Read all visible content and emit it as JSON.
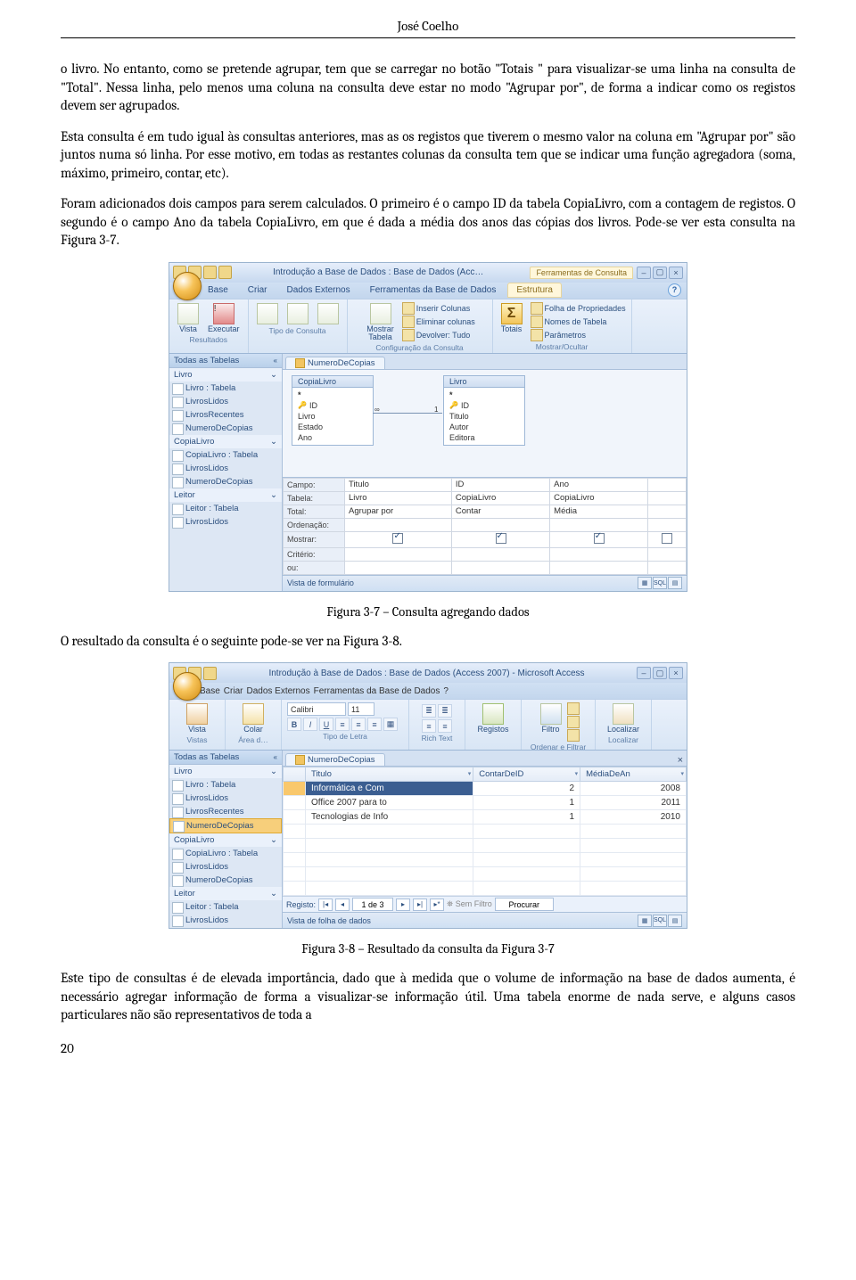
{
  "header": {
    "author": "José Coelho"
  },
  "paras": {
    "p1": "o livro. No entanto, como se pretende agrupar, tem que se carregar no botão \"Totais \" para visualizar-se uma linha na consulta de \"Total\". Nessa linha, pelo menos uma coluna na consulta deve estar no modo \"Agrupar por\", de forma a indicar como os registos devem ser agrupados.",
    "p2": "Esta consulta é em tudo igual às consultas anteriores, mas as os registos que tiverem o mesmo valor na coluna em \"Agrupar por\" são juntos numa só linha. Por esse motivo, em todas as restantes colunas da consulta tem que se indicar uma função agregadora (soma, máximo, primeiro, contar, etc).",
    "p3": "Foram adicionados dois campos para serem calculados. O primeiro é o campo ID da tabela CopiaLivro, com a contagem de registos. O segundo é o campo Ano da tabela CopiaLivro, em que é dada a média dos anos das cópias dos livros. Pode-se ver esta consulta na Figura 3-7.",
    "cap1": "Figura 3-7 – Consulta agregando dados",
    "p4": "O resultado da consulta é o seguinte pode-se ver na Figura 3-8.",
    "cap2": "Figura 3-8 – Resultado da consulta da Figura 3-7",
    "p5": "Este tipo de consultas é de elevada importância, dado que à medida que o volume de informação na base de dados aumenta, é necessário agregar informação de forma a visualizar-se informação útil. Uma tabela enorme de nada serve, e alguns casos particulares não são representativos de toda a",
    "pagenum": "20"
  },
  "shot1": {
    "title": "Introdução a Base de Dados : Base de Dados (Acc…",
    "ctxTitle": "Ferramentas de Consulta",
    "tabs": {
      "base": "Base",
      "criar": "Criar",
      "dados": "Dados Externos",
      "ferr": "Ferramentas da Base de Dados",
      "estrutura": "Estrutura"
    },
    "ribbon": {
      "vista": "Vista",
      "executar": "Executar",
      "resultados": "Resultados",
      "tipo": "Tipo de Consulta",
      "mostrarTabela": "Mostrar\nTabela",
      "inserir": "Inserir Colunas",
      "eliminar": "Eliminar colunas",
      "devolver": "Devolver: Tudo",
      "config": "Configuração da Consulta",
      "totais": "Totais",
      "folha": "Folha de Propriedades",
      "nomes": "Nomes de Tabela",
      "param": "Parâmetros",
      "mostocul": "Mostrar/Ocultar"
    },
    "nav": {
      "header": "Todas as Tabelas",
      "g1": "Livro",
      "g1items": [
        "Livro : Tabela",
        "LivrosLidos",
        "LivrosRecentes",
        "NumeroDeCopias"
      ],
      "g2": "CopiaLivro",
      "g2items": [
        "CopiaLivro : Tabela",
        "LivrosLidos",
        "NumeroDeCopias"
      ],
      "g3": "Leitor",
      "g3items": [
        "Leitor : Tabela",
        "LivrosLidos"
      ]
    },
    "designTab": "NumeroDeCopias",
    "box1": {
      "title": "CopiaLivro",
      "fields": [
        "*",
        "ID",
        "Livro",
        "Estado",
        "Ano"
      ]
    },
    "box2": {
      "title": "Livro",
      "fields": [
        "*",
        "ID",
        "Titulo",
        "Autor",
        "Editora"
      ]
    },
    "grid": {
      "rows": [
        "Campo:",
        "Tabela:",
        "Total:",
        "Ordenação:",
        "Mostrar:",
        "Critério:",
        "ou:"
      ],
      "cols": [
        {
          "campo": "Titulo",
          "tabela": "Livro",
          "total": "Agrupar por",
          "mostrar": true
        },
        {
          "campo": "ID",
          "tabela": "CopiaLivro",
          "total": "Contar",
          "mostrar": true
        },
        {
          "campo": "Ano",
          "tabela": "CopiaLivro",
          "total": "Média",
          "mostrar": true
        }
      ]
    },
    "status": "Vista de formulário"
  },
  "shot2": {
    "title": "Introdução à Base de Dados : Base de Dados (Access 2007) - Microsoft Access",
    "tabs": {
      "base": "Base",
      "criar": "Criar",
      "dados": "Dados Externos",
      "ferr": "Ferramentas da Base de Dados"
    },
    "ribbon": {
      "vista": "Vista",
      "colar": "Colar",
      "vistas": "Vistas",
      "areatransf": "Área d…",
      "font": "Calibri",
      "size": "11",
      "tipoLetra": "Tipo de Letra",
      "richtext": "Rich Text",
      "registos": "Registos",
      "filtro": "Filtro",
      "ordfilt": "Ordenar e Filtrar",
      "localizar": "Localizar",
      "locG": "Localizar"
    },
    "nav": {
      "header": "Todas as Tabelas",
      "g1": "Livro",
      "g1items": [
        "Livro : Tabela",
        "LivrosLidos",
        "LivrosRecentes",
        "NumeroDeCopias"
      ],
      "g2": "CopiaLivro",
      "g2items": [
        "CopiaLivro : Tabela",
        "LivrosLidos",
        "NumeroDeCopias"
      ],
      "g3": "Leitor",
      "g3items": [
        "Leitor : Tabela",
        "LivrosLidos"
      ]
    },
    "designTab": "NumeroDeCopias",
    "columns": [
      "Titulo",
      "ContarDeID",
      "MédiaDeAn"
    ],
    "rows": [
      {
        "t": "Informática e Com",
        "c": "2",
        "m": "2008"
      },
      {
        "t": "Office 2007 para to",
        "c": "1",
        "m": "2011"
      },
      {
        "t": "Tecnologias de Info",
        "c": "1",
        "m": "2010"
      }
    ],
    "recnav": {
      "label": "Registo:",
      "pos": "1 de 3",
      "semfiltro": "Sem Filtro",
      "procurar": "Procurar"
    },
    "status": "Vista de folha de dados"
  },
  "chart_data": {
    "type": "table",
    "title": "NumeroDeCopias query result",
    "columns": [
      "Titulo",
      "ContarDeID",
      "MédiaDeAn"
    ],
    "rows": [
      [
        "Informática e Com",
        2,
        2008
      ],
      [
        "Office 2007 para to",
        1,
        2011
      ],
      [
        "Tecnologias de Info",
        1,
        2010
      ]
    ]
  }
}
